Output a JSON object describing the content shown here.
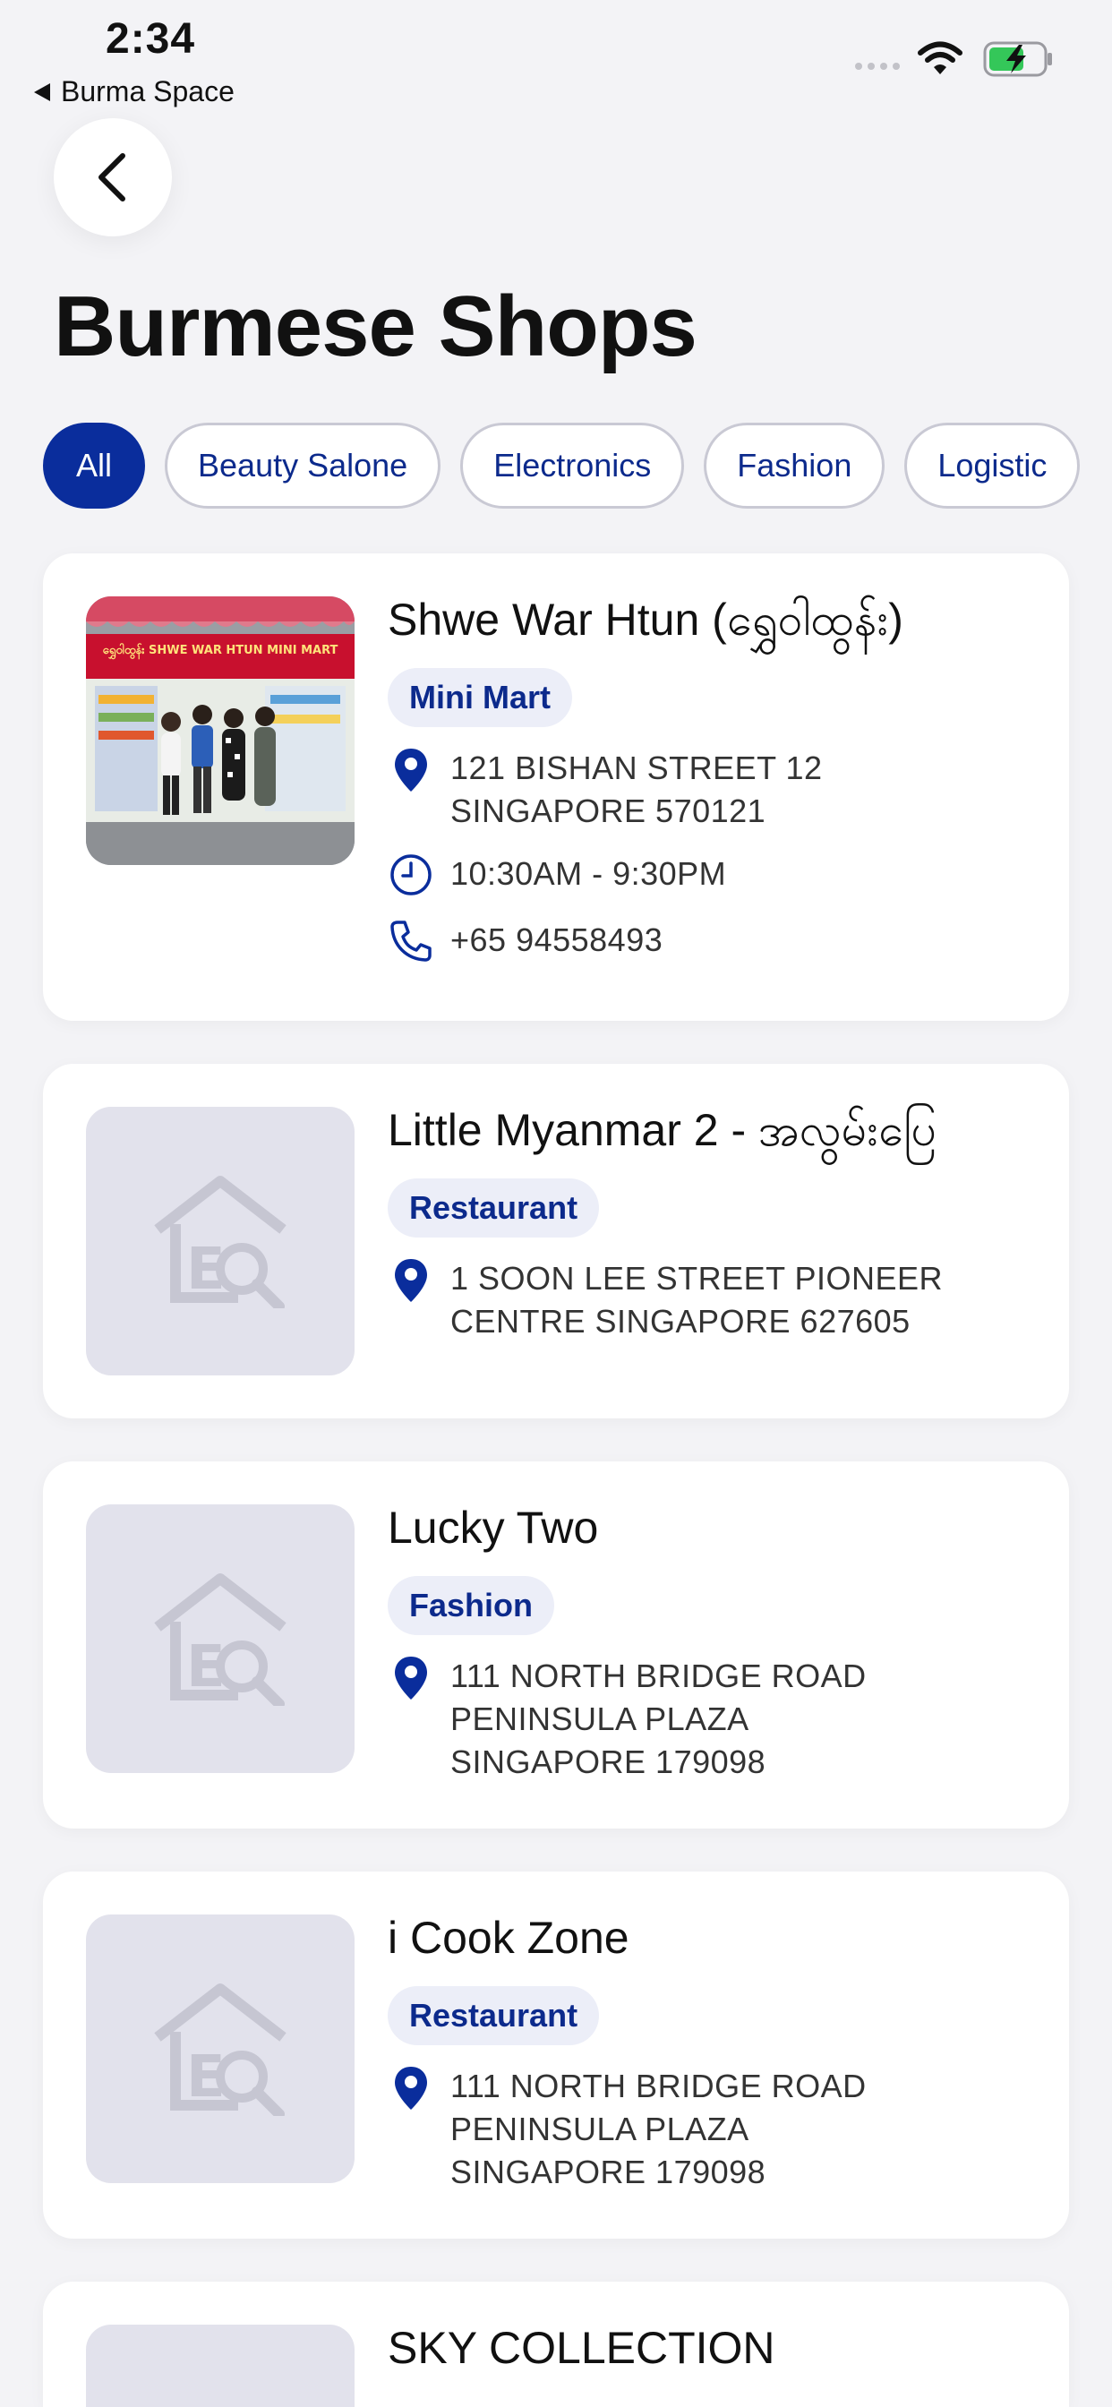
{
  "status": {
    "time": "2:34",
    "back_app": "Burma Space"
  },
  "header": {
    "title": "Burmese Shops"
  },
  "filters": [
    "All",
    "Beauty Salone",
    "Electronics",
    "Fashion",
    "Logistic"
  ],
  "colors": {
    "accent": "#0a2d9c",
    "badge_bg": "#eceef8",
    "placeholder_bg": "#e2e2ec"
  },
  "shops": [
    {
      "name": "Shwe War Htun (ရွှေဝါထွန်း)",
      "category": "Mini Mart",
      "address": "121 BISHAN STREET 12 SINGAPORE 570121",
      "hours": "10:30AM - 9:30PM",
      "phone": "+65 94558493",
      "photo_sign": "ရွှေဝါထွန်း SHWE WAR HTUN MINI MART"
    },
    {
      "name": "Little Myanmar 2 - အလွမ်းပြေ",
      "category": "Restaurant",
      "address": "1 SOON LEE STREET PIONEER CENTRE SINGAPORE 627605"
    },
    {
      "name": "Lucky Two",
      "category": "Fashion",
      "address": "111 NORTH BRIDGE ROAD PENINSULA PLAZA SINGAPORE 179098"
    },
    {
      "name": "i Cook Zone",
      "category": "Restaurant",
      "address": "111 NORTH BRIDGE ROAD PENINSULA PLAZA SINGAPORE 179098"
    },
    {
      "name": "SKY COLLECTION"
    }
  ]
}
